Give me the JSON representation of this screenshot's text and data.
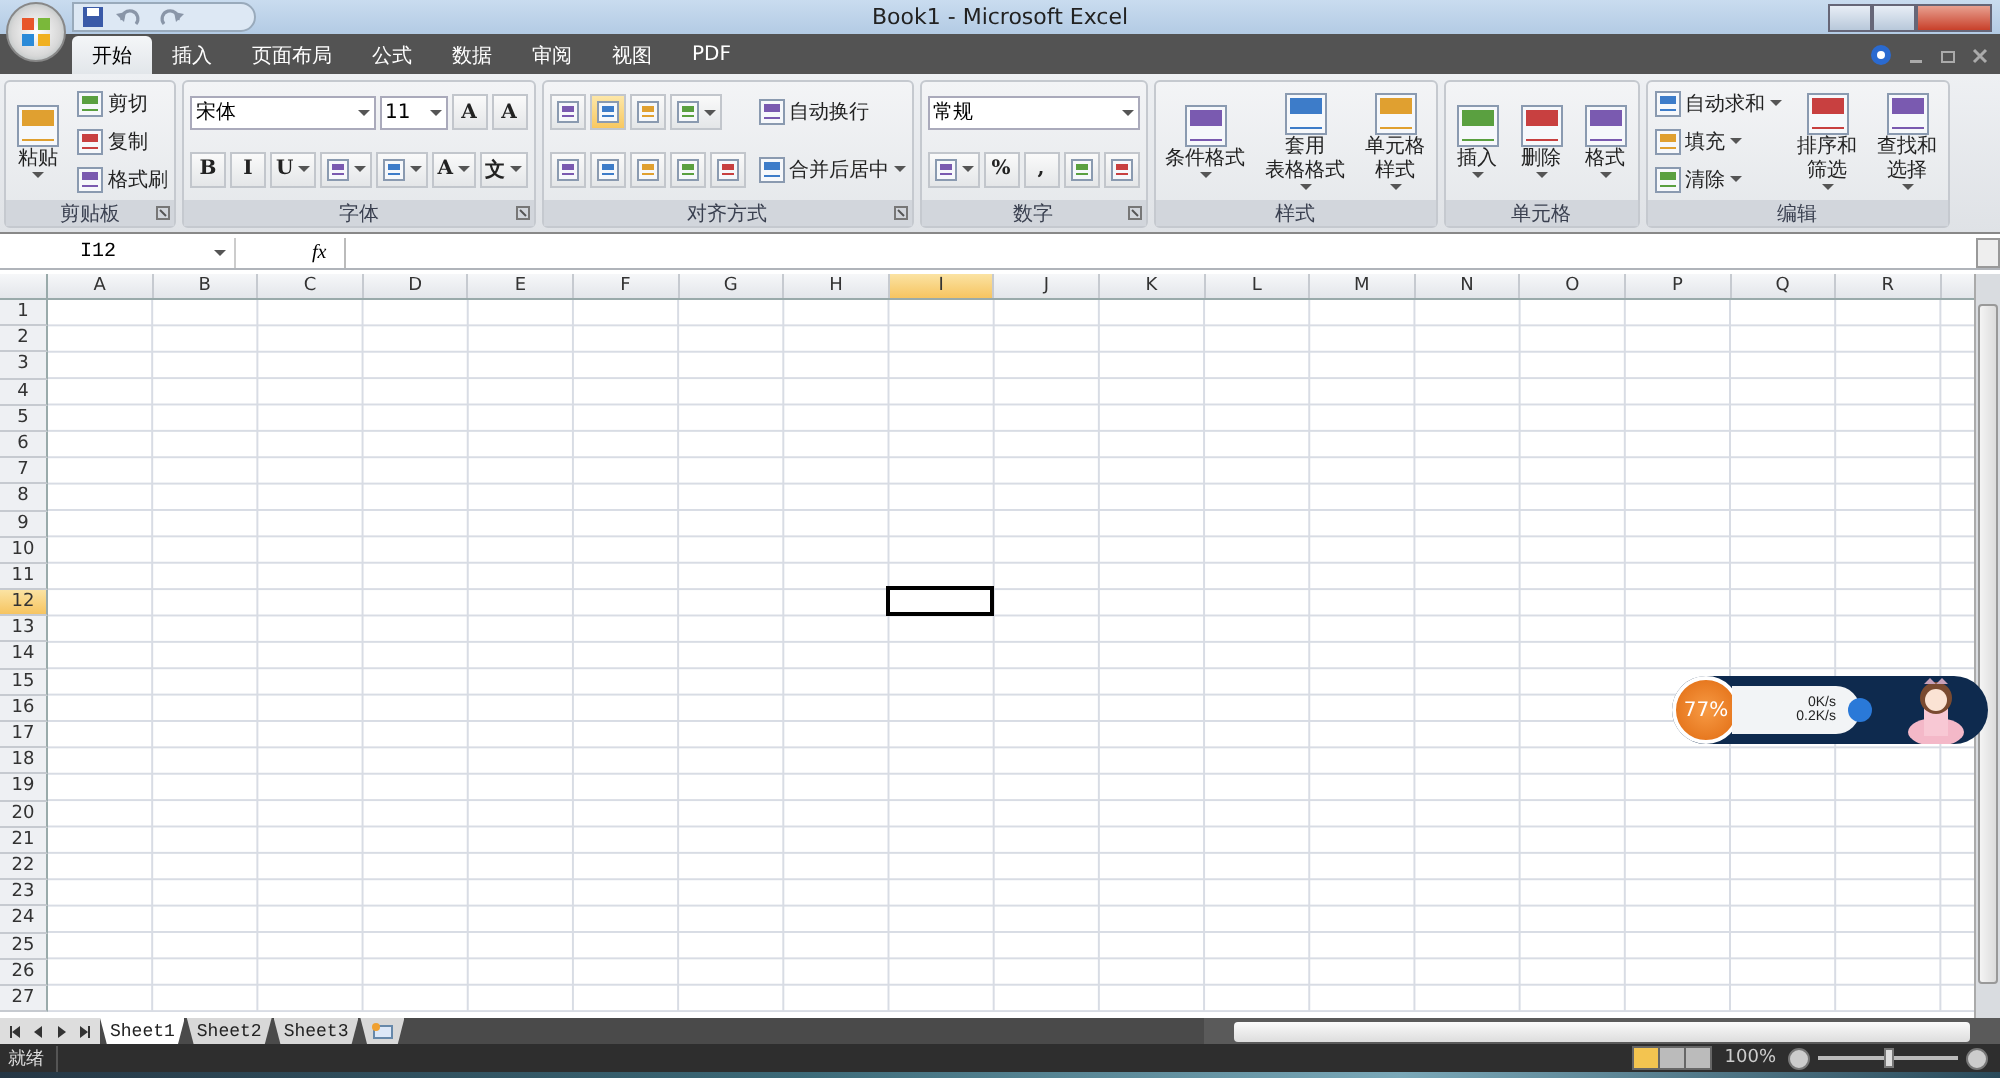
{
  "window": {
    "title": "Book1 - Microsoft Excel"
  },
  "tabs": [
    {
      "label": "开始",
      "selected": true
    },
    {
      "label": "插入",
      "selected": false
    },
    {
      "label": "页面布局",
      "selected": false
    },
    {
      "label": "公式",
      "selected": false
    },
    {
      "label": "数据",
      "selected": false
    },
    {
      "label": "审阅",
      "selected": false
    },
    {
      "label": "视图",
      "selected": false
    },
    {
      "label": "PDF",
      "selected": false
    }
  ],
  "ribbon": [
    {
      "title": "剪贴板",
      "columns": [
        [
          {
            "kind": "large",
            "lines": [
              "粘贴"
            ],
            "dropdown": true
          }
        ],
        [
          {
            "kind": "small",
            "label": "剪切"
          },
          {
            "kind": "small",
            "label": "复制"
          },
          {
            "kind": "small",
            "label": "格式刷"
          }
        ]
      ]
    },
    {
      "title": "字体",
      "columns": [
        [
          {
            "kind": "row",
            "items": [
              {
                "kind": "field",
                "value": "宋体"
              },
              {
                "kind": "field",
                "value": "11"
              },
              {
                "kind": "tool",
                "label": "A"
              },
              {
                "kind": "tool",
                "label": "A"
              }
            ]
          },
          {
            "kind": "row",
            "items": [
              {
                "kind": "tool",
                "label": "B"
              },
              {
                "kind": "tool",
                "label": "I"
              },
              {
                "kind": "tool",
                "label": "U",
                "dropdown": true
              },
              {
                "kind": "icon",
                "dropdown": true
              },
              {
                "kind": "icon",
                "dropdown": true
              },
              {
                "kind": "tool",
                "label": "A",
                "dropdown": true
              },
              {
                "kind": "tool",
                "label": "文",
                "dropdown": true
              }
            ]
          }
        ]
      ]
    },
    {
      "title": "对齐方式",
      "columns": [
        [
          {
            "kind": "row",
            "items": [
              {
                "kind": "icon",
                "selected": false
              },
              {
                "kind": "icon",
                "selected": true
              },
              {
                "kind": "icon",
                "selected": false
              },
              {
                "kind": "icon",
                "dropdown": true
              }
            ]
          },
          {
            "kind": "row",
            "items": [
              {
                "kind": "icon",
                "selected": false
              },
              {
                "kind": "icon",
                "selected": false
              },
              {
                "kind": "icon",
                "selected": false
              },
              {
                "kind": "icon"
              },
              {
                "kind": "icon"
              }
            ]
          }
        ],
        [
          {
            "kind": "small",
            "label": "自动换行"
          },
          {
            "kind": "small",
            "label": "合并后居中",
            "dropdown": true
          }
        ]
      ]
    },
    {
      "title": "数字",
      "columns": [
        [
          {
            "kind": "row",
            "items": [
              {
                "kind": "field",
                "value": "常规"
              }
            ]
          },
          {
            "kind": "row",
            "items": [
              {
                "kind": "icon",
                "dropdown": true
              },
              {
                "kind": "tool",
                "label": "%"
              },
              {
                "kind": "tool",
                "label": ","
              },
              {
                "kind": "icon"
              },
              {
                "kind": "icon"
              }
            ]
          }
        ]
      ]
    },
    {
      "title": "样式",
      "columns": [
        [
          {
            "kind": "large",
            "lines": [
              "条件格式"
            ],
            "dropdown": true
          }
        ],
        [
          {
            "kind": "large",
            "lines": [
              "套用",
              "表格格式"
            ],
            "dropdown": true
          }
        ],
        [
          {
            "kind": "large",
            "lines": [
              "单元格",
              "样式"
            ],
            "dropdown": true
          }
        ]
      ]
    },
    {
      "title": "单元格",
      "columns": [
        [
          {
            "kind": "large",
            "lines": [
              "插入"
            ],
            "dropdown": true
          }
        ],
        [
          {
            "kind": "large",
            "lines": [
              "删除"
            ],
            "dropdown": true
          }
        ],
        [
          {
            "kind": "large",
            "lines": [
              "格式"
            ],
            "dropdown": true
          }
        ]
      ]
    },
    {
      "title": "编辑",
      "columns": [
        [
          {
            "kind": "small",
            "label": "自动求和",
            "dropdown": true
          },
          {
            "kind": "small",
            "label": "填充",
            "dropdown": true
          },
          {
            "kind": "small",
            "label": "清除",
            "dropdown": true
          }
        ],
        [
          {
            "kind": "large",
            "lines": [
              "排序和",
              "筛选"
            ],
            "dropdown": true
          }
        ],
        [
          {
            "kind": "large",
            "lines": [
              "查找和",
              "选择"
            ],
            "dropdown": true
          }
        ]
      ]
    }
  ],
  "formula_bar": {
    "name_box": "I12",
    "function_label": "fx"
  },
  "sheet": {
    "columns": [
      {
        "label": "A",
        "selected": false
      },
      {
        "label": "B",
        "selected": false
      },
      {
        "label": "C",
        "selected": false
      },
      {
        "label": "D",
        "selected": false
      },
      {
        "label": "E",
        "selected": false
      },
      {
        "label": "F",
        "selected": false
      },
      {
        "label": "G",
        "selected": false
      },
      {
        "label": "H",
        "selected": false
      },
      {
        "label": "I",
        "selected": true
      },
      {
        "label": "J",
        "selected": false
      },
      {
        "label": "K",
        "selected": false
      },
      {
        "label": "L",
        "selected": false
      },
      {
        "label": "M",
        "selected": false
      },
      {
        "label": "N",
        "selected": false
      },
      {
        "label": "O",
        "selected": false
      },
      {
        "label": "P",
        "selected": false
      },
      {
        "label": "Q",
        "selected": false
      },
      {
        "label": "R",
        "selected": false
      }
    ],
    "rows": [
      {
        "label": "1",
        "selected": false
      },
      {
        "label": "2",
        "selected": false
      },
      {
        "label": "3",
        "selected": false
      },
      {
        "label": "4",
        "selected": false
      },
      {
        "label": "5",
        "selected": false
      },
      {
        "label": "6",
        "selected": false
      },
      {
        "label": "7",
        "selected": false
      },
      {
        "label": "8",
        "selected": false
      },
      {
        "label": "9",
        "selected": false
      },
      {
        "label": "10",
        "selected": false
      },
      {
        "label": "11",
        "selected": false
      },
      {
        "label": "12",
        "selected": true
      },
      {
        "label": "13",
        "selected": false
      },
      {
        "label": "14",
        "selected": false
      },
      {
        "label": "15",
        "selected": false
      },
      {
        "label": "16",
        "selected": false
      },
      {
        "label": "17",
        "selected": false
      },
      {
        "label": "18",
        "selected": false
      },
      {
        "label": "19",
        "selected": false
      },
      {
        "label": "20",
        "selected": false
      },
      {
        "label": "21",
        "selected": false
      },
      {
        "label": "22",
        "selected": false
      },
      {
        "label": "23",
        "selected": false
      },
      {
        "label": "24",
        "selected": false
      },
      {
        "label": "25",
        "selected": false
      },
      {
        "label": "26",
        "selected": false
      },
      {
        "label": "27",
        "selected": false
      }
    ]
  },
  "sheet_tabs": [
    {
      "label": "Sheet1",
      "selected": true
    },
    {
      "label": "Sheet2",
      "selected": false
    },
    {
      "label": "Sheet3",
      "selected": false
    }
  ],
  "status_bar": {
    "status": "就绪",
    "zoom": "100%",
    "zoom_slider": {
      "level": 0.5
    },
    "views": [
      {
        "selected": true
      },
      {
        "selected": false
      },
      {
        "selected": false
      }
    ]
  },
  "net_widget": {
    "percent": "77%",
    "upload": "0K/s",
    "download": "0.2K/s"
  }
}
